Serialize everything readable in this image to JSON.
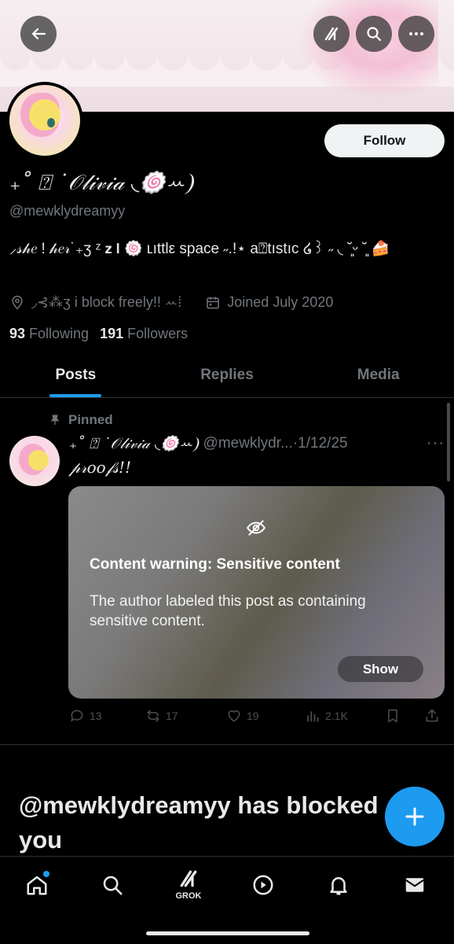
{
  "profile": {
    "display_name": "₊˚ ⍰ ˙𝒪𝓁𝒾𝓋𝒾𝒶 ◟🍥ꕀ❩",
    "handle": "@mewklydreamyy",
    "follow_label": "Follow",
    "bio": "⸝𝓈𝒽𝑒 ! 𝒽𝑒𝓇˙₊ʒ ᶻ 𝘇 𝗹 🍥 ʟıttlε space ˶.!⋆ a⍰tıstıc ໒꒱ ˶ ◟ ˘͈ᵕ ˘͈ 🍰",
    "location": "◞⊰⁂ʒ i block freely!! ꕀ⁞",
    "joined": "Joined July 2020",
    "following_count": "93",
    "following_label": "Following",
    "followers_count": "191",
    "followers_label": "Followers"
  },
  "tabs": [
    {
      "label": "Posts",
      "active": true
    },
    {
      "label": "Replies",
      "active": false
    },
    {
      "label": "Media",
      "active": false
    }
  ],
  "post": {
    "pinned_label": "Pinned",
    "author_name": "₊˚ ⍰ ˙𝒪𝓁𝒾𝓋𝒾𝒶 ◟🍥ꕀ❩",
    "author_handle_date": "@mewklydr...·1/12/25",
    "more": "···",
    "text": "𝓅𝓇𝑜𝑜𝒻𝓈!!",
    "content_warning": {
      "title": "Content warning: Sensitive content",
      "body": "The author labeled this post as containing sensitive content.",
      "show_label": "Show"
    },
    "stats": {
      "replies": "13",
      "reposts": "17",
      "likes": "19",
      "views": "2.1K"
    }
  },
  "blocked_message": "@mewklydreamyy has blocked you",
  "colors": {
    "accent": "#1d9bf0",
    "muted": "#71767b",
    "text": "#e7e9ea"
  },
  "bottom_nav": {
    "grok_label": "GROK"
  }
}
